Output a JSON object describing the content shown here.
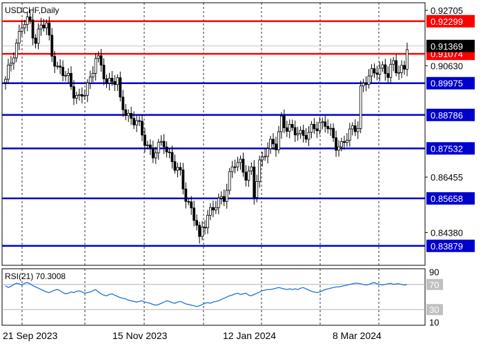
{
  "chart_data": [
    {
      "type": "candlestick",
      "title": "USDCHF,Daily",
      "y_axis_ticks": [
        "0.92705",
        "0.90630",
        "0.86455",
        "0.84380"
      ],
      "ylim": [
        0.8315,
        0.9299
      ],
      "x_axis_ticks": [
        "21 Sep 2023",
        "15 Nov 2023",
        "12 Jan 2024",
        "8 Mar 2024"
      ],
      "current_price": "0.91369",
      "colors": {
        "resistance": "#ff0000",
        "support": "#0000cd",
        "current": "#000000",
        "candle": "#000000"
      },
      "levels": [
        {
          "label": "0.92299",
          "value": 0.92299,
          "kind": "resistance"
        },
        {
          "label": "0.91074",
          "value": 0.91074,
          "kind": "resistance"
        },
        {
          "label": "0.89975",
          "value": 0.89975,
          "kind": "support"
        },
        {
          "label": "0.88786",
          "value": 0.88786,
          "kind": "support"
        },
        {
          "label": "0.87532",
          "value": 0.87532,
          "kind": "support"
        },
        {
          "label": "0.85658",
          "value": 0.85658,
          "kind": "support"
        },
        {
          "label": "0.83879",
          "value": 0.83879,
          "kind": "support"
        }
      ],
      "close_path": [
        [
          0,
          0.9
        ],
        [
          3,
          0.912
        ],
        [
          6,
          0.921
        ],
        [
          9,
          0.923
        ],
        [
          11,
          0.916
        ],
        [
          13,
          0.921
        ],
        [
          15,
          0.921
        ],
        [
          17,
          0.912
        ],
        [
          19,
          0.905
        ],
        [
          21,
          0.903
        ],
        [
          23,
          0.902
        ],
        [
          25,
          0.897
        ],
        [
          27,
          0.893
        ],
        [
          29,
          0.896
        ],
        [
          31,
          0.902
        ],
        [
          33,
          0.91
        ],
        [
          35,
          0.905
        ],
        [
          37,
          0.9
        ],
        [
          39,
          0.902
        ],
        [
          41,
          0.9
        ],
        [
          42,
          0.892
        ],
        [
          44,
          0.889
        ],
        [
          46,
          0.887
        ],
        [
          48,
          0.885
        ],
        [
          50,
          0.88
        ],
        [
          52,
          0.877
        ],
        [
          54,
          0.873
        ],
        [
          56,
          0.875
        ],
        [
          58,
          0.878
        ],
        [
          60,
          0.873
        ],
        [
          62,
          0.868
        ],
        [
          64,
          0.865
        ],
        [
          66,
          0.858
        ],
        [
          68,
          0.852
        ],
        [
          70,
          0.846
        ],
        [
          71,
          0.84
        ],
        [
          72,
          0.846
        ],
        [
          74,
          0.851
        ],
        [
          76,
          0.852
        ],
        [
          78,
          0.855
        ],
        [
          80,
          0.858
        ],
        [
          82,
          0.865
        ],
        [
          84,
          0.869
        ],
        [
          86,
          0.87
        ],
        [
          88,
          0.866
        ],
        [
          90,
          0.866
        ],
        [
          91,
          0.857
        ],
        [
          93,
          0.87
        ],
        [
          95,
          0.875
        ],
        [
          97,
          0.876
        ],
        [
          99,
          0.876
        ],
        [
          101,
          0.887
        ],
        [
          103,
          0.883
        ],
        [
          105,
          0.881
        ],
        [
          107,
          0.882
        ],
        [
          109,
          0.881
        ],
        [
          111,
          0.88
        ],
        [
          113,
          0.883
        ],
        [
          115,
          0.885
        ],
        [
          117,
          0.885
        ],
        [
          119,
          0.88
        ],
        [
          121,
          0.877
        ],
        [
          123,
          0.877
        ],
        [
          125,
          0.879
        ],
        [
          127,
          0.882
        ],
        [
          129,
          0.885
        ],
        [
          130,
          0.898
        ],
        [
          132,
          0.9
        ],
        [
          134,
          0.903
        ],
        [
          136,
          0.906
        ],
        [
          138,
          0.905
        ],
        [
          140,
          0.902
        ],
        [
          142,
          0.908
        ],
        [
          144,
          0.905
        ],
        [
          146,
          0.904
        ],
        [
          147,
          0.913
        ]
      ],
      "series_count_days": 148
    },
    {
      "type": "line",
      "title": "RSI(21) 70.3008",
      "y_axis_ticks": [
        "90",
        "70",
        "30",
        "10"
      ],
      "ylim": [
        5,
        95
      ],
      "reference_lines": [
        70,
        30
      ],
      "color": "#1e6fd9",
      "values": [
        68,
        65,
        67,
        70,
        72,
        71,
        69,
        72,
        73,
        71,
        68,
        66,
        64,
        62,
        60,
        58,
        57,
        59,
        61,
        62,
        60,
        57,
        55,
        56,
        58,
        57,
        59,
        60,
        58,
        56,
        57,
        58,
        60,
        62,
        58,
        55,
        53,
        52,
        54,
        55,
        53,
        51,
        49,
        48,
        47,
        45,
        44,
        43,
        42,
        43,
        44,
        42,
        41,
        40,
        38,
        37,
        38,
        40,
        42,
        44,
        43,
        41,
        40,
        42,
        43,
        41,
        39,
        38,
        37,
        36,
        35,
        36,
        38,
        40,
        41,
        40,
        42,
        43,
        44,
        46,
        48,
        50,
        52,
        53,
        55,
        56,
        54,
        55,
        56,
        53,
        52,
        54,
        56,
        58,
        60,
        61,
        62,
        62,
        63,
        64,
        65,
        64,
        63,
        62,
        63,
        62,
        63,
        62,
        64,
        65,
        63,
        61,
        59,
        58,
        57,
        58,
        60,
        62,
        63,
        64,
        65,
        66,
        66,
        67,
        68,
        69,
        70,
        71,
        72,
        72,
        71,
        70,
        69,
        70,
        72,
        73,
        71,
        70,
        69,
        70,
        71,
        72,
        70,
        71,
        71,
        70,
        69,
        70
      ]
    }
  ]
}
